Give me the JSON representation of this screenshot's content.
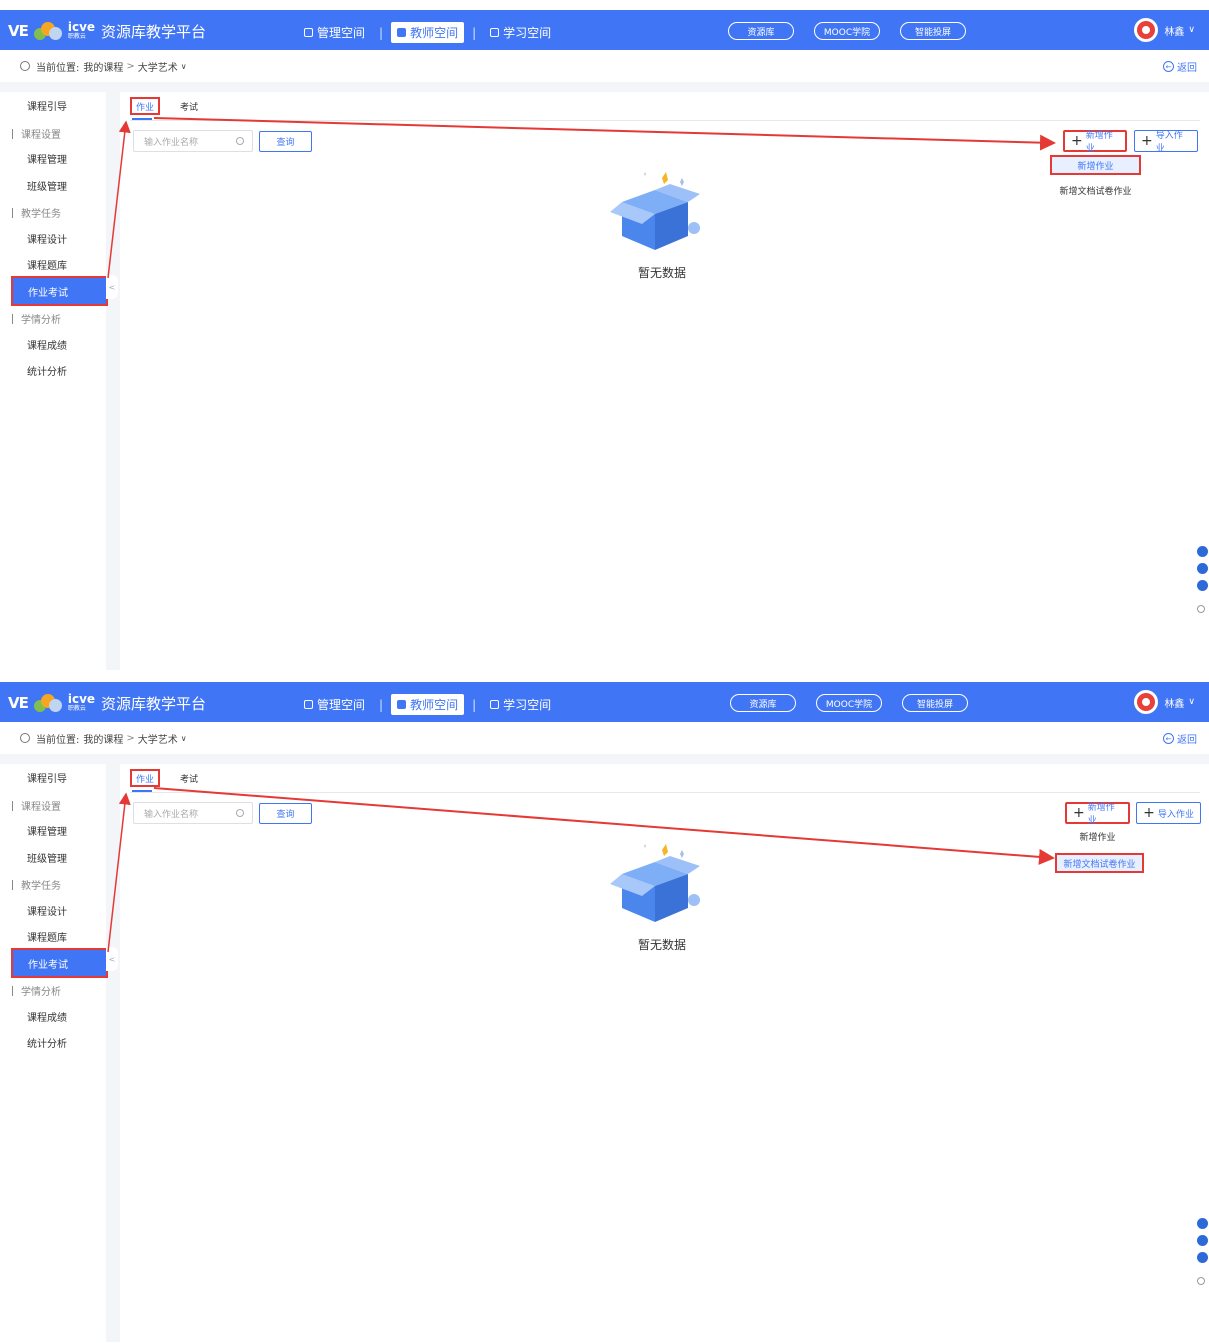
{
  "header": {
    "logo_ve": "VE",
    "logo_icve": "icve",
    "logo_icve_sub": "职教云",
    "app_title": "资源库教学平台",
    "spaces": [
      "管理空间",
      "教师空间",
      "学习空间"
    ],
    "pills": [
      "资源库",
      "MOOC学院",
      "智能投屏"
    ],
    "user_name": "林鑫",
    "caret": "∨"
  },
  "breadcrumb": {
    "label": "当前位置:",
    "path1": "我的课程",
    "path2": "大学艺术",
    "caret": "∨",
    "back": "返回"
  },
  "sidebar": {
    "items": [
      "课程引导",
      "课程设置",
      "课程管理",
      "班级管理",
      "教学任务",
      "课程设计",
      "课程题库",
      "作业考试",
      "学情分析",
      "课程成绩",
      "统计分析"
    ]
  },
  "main": {
    "tabs": [
      "作业",
      "考试"
    ],
    "search_placeholder": "输入作业名称",
    "query_button": "查询",
    "add_button": "新增作业",
    "import_button": "导入作业",
    "menu_add": "新增作业",
    "menu_add_doc": "新增文档试卷作业",
    "empty_text": "暂无数据"
  },
  "colors": {
    "brand_blue": "#4076f6",
    "annotation_red": "#e53935"
  }
}
